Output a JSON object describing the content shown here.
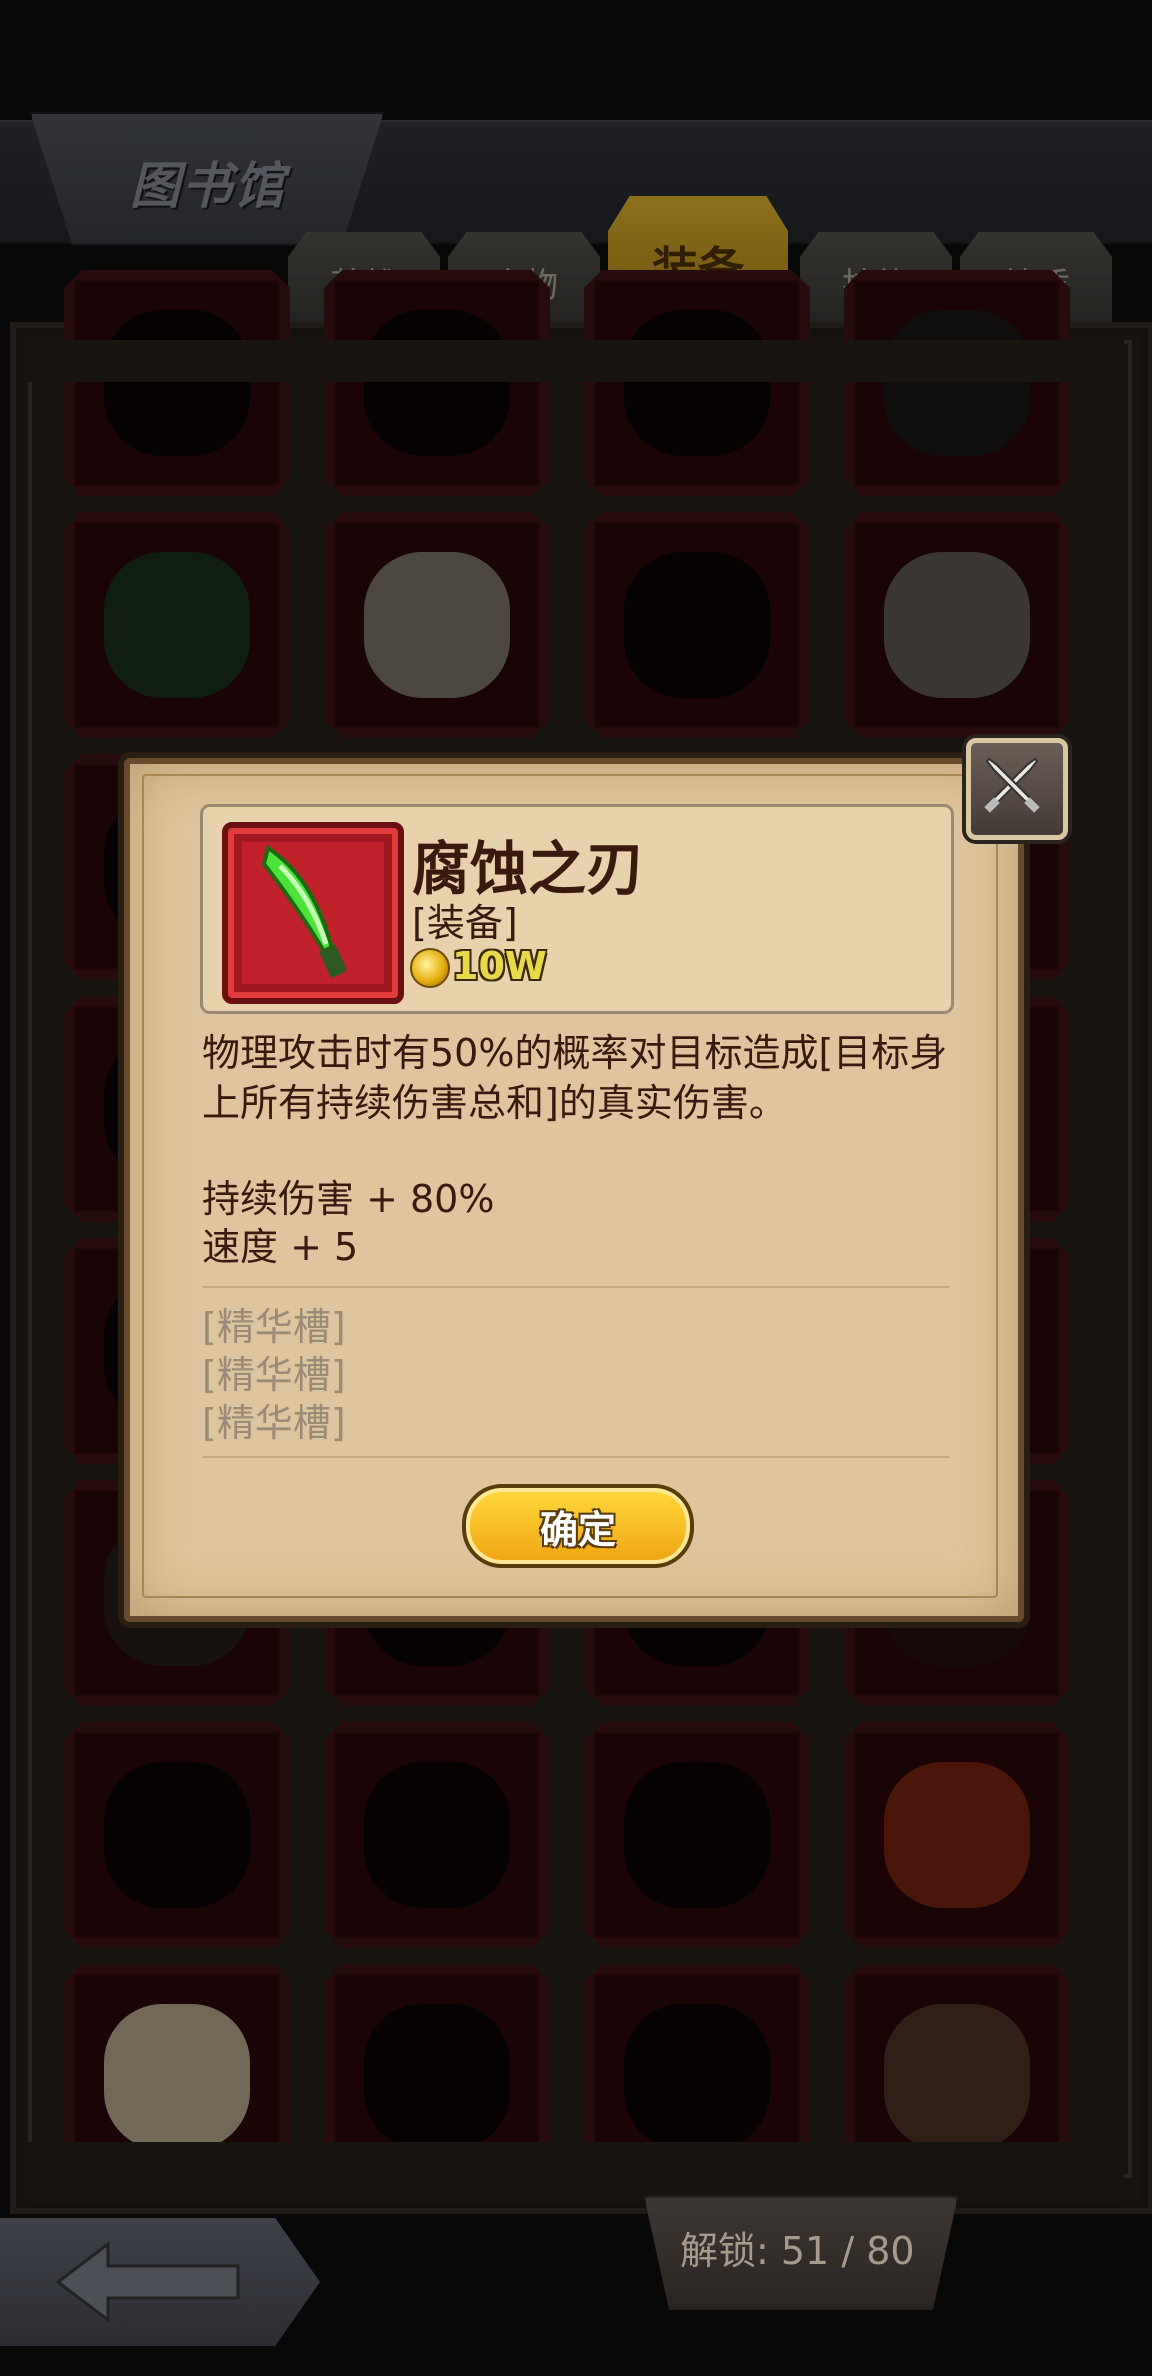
{
  "header": {
    "title": "图书馆",
    "tabs": [
      {
        "label": "英雄",
        "active": false
      },
      {
        "label": "魔物",
        "active": false
      },
      {
        "label": "装备",
        "active": true
      },
      {
        "label": "技能",
        "active": false
      },
      {
        "label": "特质",
        "active": false
      }
    ]
  },
  "modal": {
    "item_name": "腐蚀之刃",
    "item_type": "[装备]",
    "price": "10W",
    "description": "物理攻击时有50%的概率对目标造成[目标身上所有持续伤害总和]的真实伤害。",
    "stats": [
      "持续伤害 + 80%",
      "速度 + 5"
    ],
    "slots": [
      "[精华槽]",
      "[精华槽]",
      "[精华槽]"
    ],
    "confirm_label": "确定"
  },
  "footer": {
    "unlock_text": "解锁: 51 / 80"
  }
}
